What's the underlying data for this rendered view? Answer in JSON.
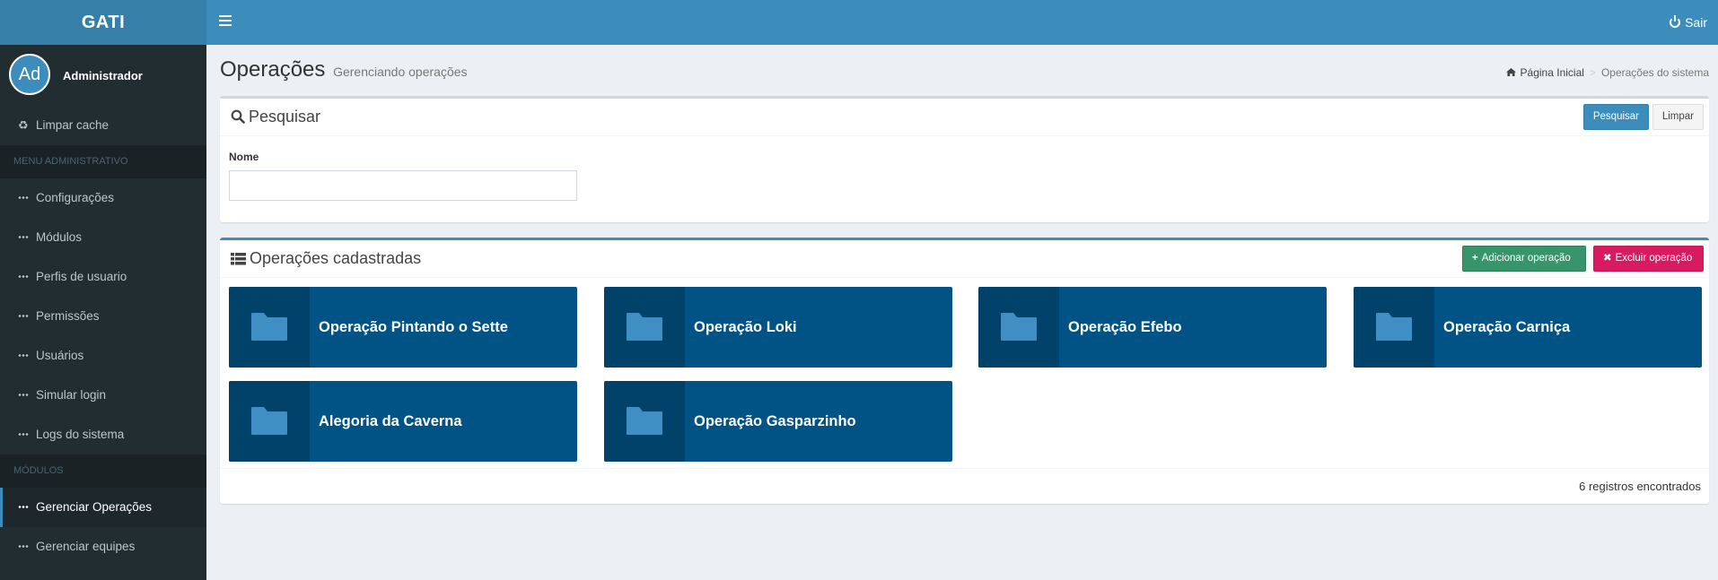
{
  "app": {
    "logo": "GATI",
    "logout_label": "Sair"
  },
  "user": {
    "initials": "Ad",
    "name": "Administrador"
  },
  "sidebar": {
    "cache_label": "Limpar cache",
    "admin_header": "MENU ADMINISTRATIVO",
    "admin_items": [
      "Configurações",
      "Módulos",
      "Perfis de usuario",
      "Permissões",
      "Usuários",
      "Simular login",
      "Logs do sistema"
    ],
    "modules_header": "MÓDULOS",
    "module_items": [
      "Gerenciar Operações",
      "Gerenciar equipes"
    ],
    "active_item": "Gerenciar Operações"
  },
  "page": {
    "title": "Operações",
    "subtitle": "Gerenciando operações",
    "breadcrumb": {
      "home": "Página Inicial",
      "current": "Operações do sistema"
    }
  },
  "search_box": {
    "title": "Pesquisar",
    "search_button": "Pesquisar",
    "clear_button": "Limpar",
    "field_label": "Nome",
    "field_value": "",
    "field_placeholder": ""
  },
  "list_box": {
    "title": "Operações cadastradas",
    "add_button": "Adicionar operação",
    "delete_button": "Excluir operação",
    "tiles": [
      "Operação Pintando o Sette",
      "Operação Loki",
      "Operação Efebo",
      "Operação Carniça",
      "Alegoria da Caverna",
      "Operação Gasparzinho"
    ],
    "footer_count": "6 registros encontrados"
  },
  "colors": {
    "header": "#3c8dbc",
    "logo_bg": "#367fa9",
    "sidebar": "#222d32",
    "tile": "#005384",
    "add_button": "#38946a",
    "delete_button": "#d81b60"
  }
}
